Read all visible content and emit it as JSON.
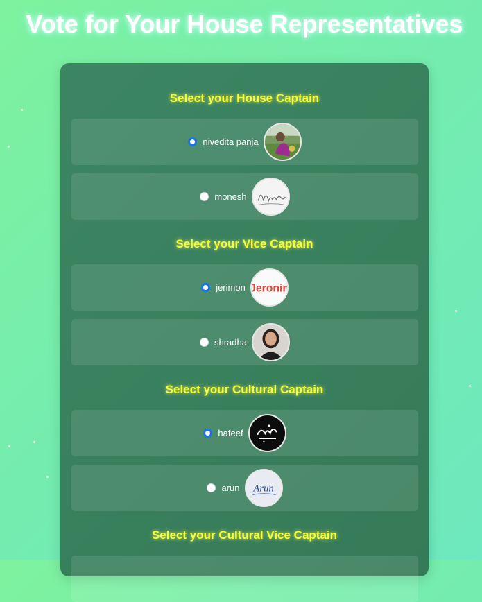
{
  "page": {
    "title": "Vote for Your House Representatives"
  },
  "sections": [
    {
      "title": "Select your House Captain",
      "candidates": [
        {
          "name": "nivedita panja",
          "selected": true,
          "avatar": "photo-girl-garden-icon"
        },
        {
          "name": "monesh",
          "selected": false,
          "avatar": "signature-monesh-icon"
        }
      ]
    },
    {
      "title": "Select your Vice Captain",
      "candidates": [
        {
          "name": "jerimon",
          "selected": true,
          "avatar": "colorful-text-jeronin-icon",
          "avatar_text": "Jeronin"
        },
        {
          "name": "shradha",
          "selected": false,
          "avatar": "photo-girl-portrait-icon"
        }
      ]
    },
    {
      "title": "Select your Cultural Captain",
      "candidates": [
        {
          "name": "hafeef",
          "selected": true,
          "avatar": "arabic-calligraphy-icon"
        },
        {
          "name": "arun",
          "selected": false,
          "avatar": "signature-arun-icon",
          "avatar_text": "Arun"
        }
      ]
    },
    {
      "title": "Select your Cultural Vice Captain",
      "candidates": []
    }
  ],
  "colors": {
    "accent": "#1a73e8",
    "section_title": "#f6ff38",
    "card": "#3c8563"
  }
}
